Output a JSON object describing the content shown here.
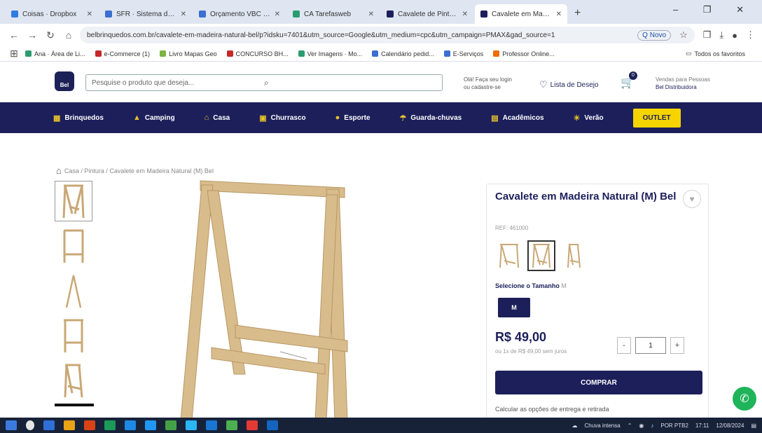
{
  "browser": {
    "tabs": [
      {
        "title": "Coisas · Dropbox",
        "color": "#2f7be0",
        "active": false
      },
      {
        "title": "SFR · Sistema de Gestão",
        "color": "#3b6fd1",
        "active": false
      },
      {
        "title": "Orçamento VBC Crédito",
        "color": "#3b6fd1",
        "active": false
      },
      {
        "title": "CA Tarefasweb",
        "color": "#2c9b6f",
        "active": false
      },
      {
        "title": "Cavalete de Pintura para P...",
        "color": "#1c1f5a",
        "active": false
      },
      {
        "title": "Cavalete em Madeira Na...",
        "color": "#1c1f5a",
        "active": true
      }
    ],
    "new_tab": "+",
    "window_controls": "– ❐ ✕",
    "url": "belbrinquedos.com.br/cavalete-em-madeira-natural-bel/p?idsku=7401&utm_source=Google&utm_medium=cpc&utm_campaign=PMAX&gad_source=1",
    "url_button": "Q Novo",
    "bookmarks": [
      {
        "label": "Ana · Área de Li...",
        "color": "#2c9b6f"
      },
      {
        "label": "e-Commerce (1)",
        "color": "#c62828"
      },
      {
        "label": "Livro Mapas Geo",
        "color": "#7cb342"
      },
      {
        "label": "CONCURSO BH...",
        "color": "#c62828"
      },
      {
        "label": "Ver Imagens · Mo...",
        "color": "#2c9b6f"
      },
      {
        "label": "Calendário pedid...",
        "color": "#3b6fd1"
      },
      {
        "label": "E-Serviços",
        "color": "#3b6fd1"
      },
      {
        "label": "Professor Online...",
        "color": "#ef6c00"
      }
    ],
    "bookmarks_right": "Todos os favoritos"
  },
  "site": {
    "logo": "Bel",
    "search_placeholder": "Pesquise o produto que deseja...",
    "login_line1": "Olá! Faça seu login",
    "login_line2": "ou cadastre-se",
    "wishlist": "Lista de Desejo",
    "cart_count": "0",
    "business_line1": "Vendas para Pessoas",
    "business_line2": "Bel Distribuidora",
    "categories": [
      {
        "label": "Brinquedos",
        "icon": "toy-icon"
      },
      {
        "label": "Camping",
        "icon": "tent-icon"
      },
      {
        "label": "Casa",
        "icon": "house-icon"
      },
      {
        "label": "Churrasco",
        "icon": "grill-icon"
      },
      {
        "label": "Esporte",
        "icon": "ball-icon"
      },
      {
        "label": "Guarda-chuvas",
        "icon": "umbrella-icon"
      },
      {
        "label": "Acadêmicos",
        "icon": "book-icon"
      },
      {
        "label": "Verão",
        "icon": "sun-icon"
      }
    ],
    "outlet": "OUTLET",
    "breadcrumb": "Casa / Pintura / Cavalete em Madeira Natural (M) Bel"
  },
  "product": {
    "title": "Cavalete em Madeira Natural (M) Bel",
    "sku": "REF: 461000",
    "size_label": "Selecione o Tamanho",
    "size_hint": "M",
    "selected_size": "M",
    "price": "R$ 49,00",
    "installments": "ou 1x de R$ 49,00 sem juros",
    "quantity": "1",
    "qty_minus": "-",
    "qty_plus": "+",
    "buy_button": "COMPRAR",
    "shipping": "Calcular as opções de entrega e retirada"
  },
  "taskbar": {
    "weather": "Chuva intensa",
    "lang": "POR PTB2",
    "time": "17:11",
    "date": "12/08/2024",
    "icons": [
      "#3b7be0",
      "#e5e5e5",
      "#2f6fd8",
      "#e8a317",
      "#d84315",
      "#1b9a59",
      "#1e88e5",
      "#2196f3",
      "#43a047",
      "#2ab5f6",
      "#1976d2",
      "#4caf50",
      "#e53935",
      "#1565c0"
    ]
  },
  "colors": {
    "brand": "#1c1f5a",
    "outlet": "#f5d400",
    "whatsapp": "#1fb45a"
  }
}
